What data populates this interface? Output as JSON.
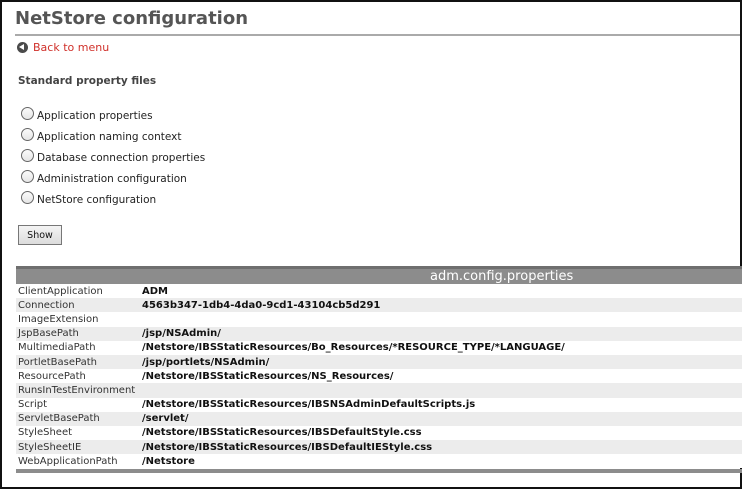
{
  "page": {
    "title": "NetStore configuration",
    "back_label": "Back to menu"
  },
  "properties_section": {
    "label": "Standard property files",
    "options": [
      "Application properties",
      "Application naming context",
      "Database connection properties",
      "Administration configuration",
      "NetStore configuration"
    ],
    "show_label": "Show"
  },
  "config_table": {
    "header": "adm.config.properties",
    "rows": [
      {
        "key": "ClientApplication",
        "value": "ADM"
      },
      {
        "key": "Connection",
        "value": "4563b347-1db4-4da0-9cd1-43104cb5d291"
      },
      {
        "key": "ImageExtension",
        "value": ""
      },
      {
        "key": "JspBasePath",
        "value": "/jsp/NSAdmin/"
      },
      {
        "key": "MultimediaPath",
        "value": "/Netstore/IBSStaticResources/Bo_Resources/*RESOURCE_TYPE/*LANGUAGE/"
      },
      {
        "key": "PortletBasePath",
        "value": "/jsp/portlets/NSAdmin/"
      },
      {
        "key": "ResourcePath",
        "value": "/Netstore/IBSStaticResources/NS_Resources/"
      },
      {
        "key": "RunsInTestEnvironment",
        "value": ""
      },
      {
        "key": "Script",
        "value": "/Netstore/IBSStaticResources/IBSNSAdminDefaultScripts.js"
      },
      {
        "key": "ServletBasePath",
        "value": "/servlet/"
      },
      {
        "key": "StyleSheet",
        "value": "/Netstore/IBSStaticResources/IBSDefaultStyle.css"
      },
      {
        "key": "StyleSheetIE",
        "value": "/Netstore/IBSStaticResources/IBSDefaultIEStyle.css"
      },
      {
        "key": "WebApplicationPath",
        "value": "/Netstore"
      }
    ]
  },
  "colors": {
    "link": "#d0302a",
    "header_bar": "#8c8c8c",
    "row_alt": "#ececec"
  }
}
